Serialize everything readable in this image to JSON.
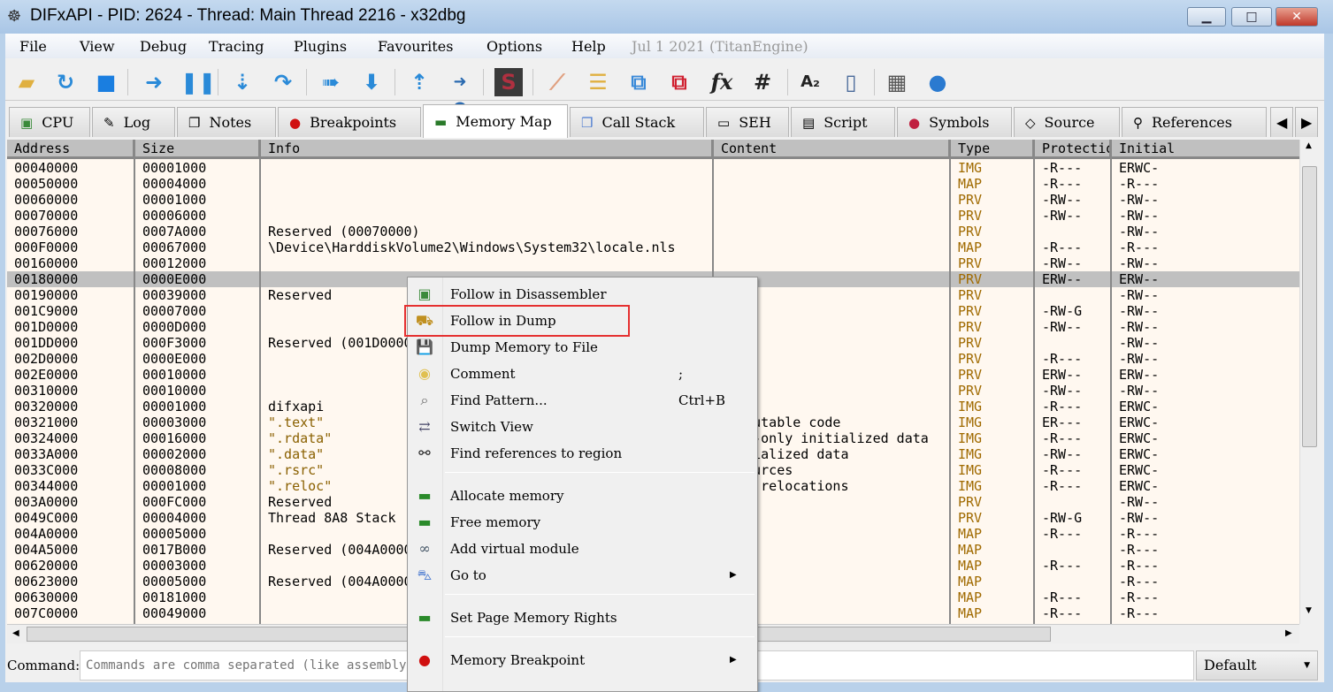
{
  "window": {
    "title": "DIFxAPI - PID: 2624 - Thread: Main Thread 2216 - x32dbg",
    "minimize": "▁",
    "maximize": "□",
    "close": "✕"
  },
  "menubar": [
    "File",
    "View",
    "Debug",
    "Tracing",
    "Plugins",
    "Favourites",
    "Options",
    "Help",
    "Jul 1 2021 (TitanEngine)"
  ],
  "toolbar": [
    "open-icon",
    "restart-icon",
    "stop-icon",
    "run-icon",
    "pause-icon",
    "step-into-icon",
    "step-over-icon",
    "trace-into-icon",
    "trace-over-icon",
    "execute-till-return-icon",
    "run-to-user-code-icon",
    "scylla-icon",
    "patch-icon",
    "comment-icon",
    "label-icon",
    "bookmark-icon",
    "function-icon",
    "hash-icon",
    "strings-icon",
    "calculator-device-icon",
    "calculator-icon",
    "globe-icon"
  ],
  "toolbar_glyphs": {
    "fx": "fx",
    "hash": "#",
    "az": "A₂",
    "scylla": "S"
  },
  "tabs": [
    "CPU",
    "Log",
    "Notes",
    "Breakpoints",
    "Memory Map",
    "Call Stack",
    "SEH",
    "Script",
    "Symbols",
    "Source",
    "References"
  ],
  "active_tab": "Memory Map",
  "columns": [
    "Address",
    "Size",
    "Info",
    "Content",
    "Type",
    "Protection",
    "Initial"
  ],
  "column_header_visible": {
    "protect": "Protecti"
  },
  "rows": [
    [
      "00040000",
      "00001000",
      "",
      "",
      "IMG",
      "-R---",
      "ERWC-"
    ],
    [
      "00050000",
      "00004000",
      "",
      "",
      "MAP",
      "-R---",
      "-R---"
    ],
    [
      "00060000",
      "00001000",
      "",
      "",
      "PRV",
      "-RW--",
      "-RW--"
    ],
    [
      "00070000",
      "00006000",
      "",
      "",
      "PRV",
      "-RW--",
      "-RW--"
    ],
    [
      "00076000",
      "0007A000",
      "Reserved (00070000)",
      "",
      "PRV",
      "",
      "-RW--"
    ],
    [
      "000F0000",
      "00067000",
      "\\Device\\HarddiskVolume2\\Windows\\System32\\locale.nls",
      "",
      "MAP",
      "-R---",
      "-R---"
    ],
    [
      "00160000",
      "00012000",
      "",
      "",
      "PRV",
      "-RW--",
      "-RW--"
    ],
    [
      "00180000",
      "0000E000",
      "",
      "",
      "PRV",
      "ERW--",
      "ERW--"
    ],
    [
      "00190000",
      "00039000",
      "Reserved",
      "",
      "PRV",
      "",
      "-RW--"
    ],
    [
      "001C9000",
      "00007000",
      "",
      "",
      "PRV",
      "-RW-G",
      "-RW--"
    ],
    [
      "001D0000",
      "0000D000",
      "",
      "",
      "PRV",
      "-RW--",
      "-RW--"
    ],
    [
      "001DD000",
      "000F3000",
      "Reserved (001D0000)",
      "",
      "PRV",
      "",
      "-RW--"
    ],
    [
      "002D0000",
      "0000E000",
      "",
      "",
      "PRV",
      "-R---",
      "-RW--"
    ],
    [
      "002E0000",
      "00010000",
      "",
      "",
      "PRV",
      "ERW--",
      "ERW--"
    ],
    [
      "00310000",
      "00010000",
      "",
      "",
      "PRV",
      "-RW--",
      "-RW--"
    ],
    [
      "00320000",
      "00001000",
      "difxapi",
      "",
      "IMG",
      "-R---",
      "ERWC-"
    ],
    [
      "00321000",
      "00003000",
      " \".text\"",
      "Executable code",
      "IMG",
      "ER---",
      "ERWC-"
    ],
    [
      "00324000",
      "00016000",
      " \".rdata\"",
      "Read-only initialized data",
      "IMG",
      "-R---",
      "ERWC-"
    ],
    [
      "0033A000",
      "00002000",
      " \".data\"",
      "Initialized data",
      "IMG",
      "-RW--",
      "ERWC-"
    ],
    [
      "0033C000",
      "00008000",
      " \".rsrc\"",
      "Resources",
      "IMG",
      "-R---",
      "ERWC-"
    ],
    [
      "00344000",
      "00001000",
      " \".reloc\"",
      "Base relocations",
      "IMG",
      "-R---",
      "ERWC-"
    ],
    [
      "003A0000",
      "000FC000",
      "Reserved",
      "",
      "PRV",
      "",
      "-RW--"
    ],
    [
      "0049C000",
      "00004000",
      "Thread 8A8 Stack",
      "",
      "PRV",
      "-RW-G",
      "-RW--"
    ],
    [
      "004A0000",
      "00005000",
      "",
      "",
      "MAP",
      "-R---",
      "-R---"
    ],
    [
      "004A5000",
      "0017B000",
      "Reserved (004A0000)",
      "",
      "MAP",
      "",
      "-R---"
    ],
    [
      "00620000",
      "00003000",
      "",
      "",
      "MAP",
      "-R---",
      "-R---"
    ],
    [
      "00623000",
      "00005000",
      "Reserved (004A0000)",
      "",
      "MAP",
      "",
      "-R---"
    ],
    [
      "00630000",
      "00181000",
      "",
      "",
      "MAP",
      "-R---",
      "-R---"
    ],
    [
      "007C0000",
      "00049000",
      "",
      "",
      "MAP",
      "-R---",
      "-R---"
    ]
  ],
  "selected_row": "00180000",
  "context_menu": [
    {
      "label": "Follow in Disassembler",
      "icon": "cpu-icon"
    },
    {
      "label": "Follow in Dump",
      "icon": "dump-truck-icon",
      "highlighted": true
    },
    {
      "label": "Dump Memory to File",
      "icon": "save-icon"
    },
    {
      "label": "Comment",
      "icon": "comment-icon",
      "shortcut": ";"
    },
    {
      "label": "Find Pattern...",
      "icon": "find-pattern-icon",
      "shortcut": "Ctrl+B"
    },
    {
      "label": "Switch View",
      "icon": "switch-view-icon"
    },
    {
      "label": "Find references to region",
      "icon": "binoculars-icon"
    },
    {
      "label": "Allocate memory",
      "icon": "memory-add-icon"
    },
    {
      "label": "Free memory",
      "icon": "memory-remove-icon"
    },
    {
      "label": "Add virtual module",
      "icon": "virtual-module-icon"
    },
    {
      "label": "Go to",
      "icon": "goto-icon",
      "submenu": true
    },
    {
      "label": "Set Page Memory Rights",
      "icon": "memory-rights-icon"
    },
    {
      "label": "Memory Breakpoint",
      "icon": "breakpoint-icon",
      "submenu": true
    }
  ],
  "command": {
    "label": "Command:",
    "placeholder": "Commands are comma separated (like assembly instructions): mov eax, ebx",
    "mode": "Default"
  },
  "colors": {
    "grid_bg": "#fff8f0",
    "selected": "#c0c0c0",
    "type_text": "#a06a00",
    "highlight_box": "#e53030"
  }
}
